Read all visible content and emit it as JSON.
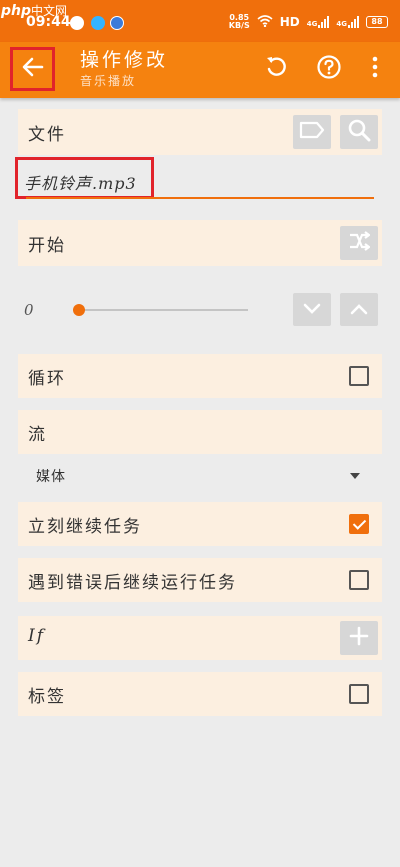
{
  "watermark": {
    "php": "php",
    "text": "中文网"
  },
  "status_bar": {
    "time": "09:44",
    "net_speed_value": "0.85",
    "net_speed_unit": "KB/S",
    "hd": "HD",
    "signal_1": "4G",
    "signal_2": "4G",
    "battery": "88"
  },
  "toolbar": {
    "title": "操作修改",
    "subtitle": "音乐播放",
    "back_icon": "arrow-left-icon",
    "undo_icon": "undo-icon",
    "help_icon": "help-circle-icon",
    "menu_icon": "more-vertical-icon"
  },
  "file_row": {
    "label": "文件",
    "file_value": "手机铃声.mp3"
  },
  "start_row": {
    "label": "开始"
  },
  "position": {
    "value": "0",
    "fraction": 0
  },
  "loop_row": {
    "label": "循环",
    "checked": false
  },
  "stream_row": {
    "label": "流",
    "selected": "媒体"
  },
  "continue_row": {
    "label": "立刻继续任务",
    "checked": true
  },
  "error_row": {
    "label": "遇到错误后继续运行任务",
    "checked": false
  },
  "if_row": {
    "label": "If"
  },
  "tag_row": {
    "label": "标签",
    "checked": false
  },
  "colors": {
    "status_bar": "#f06f0c",
    "toolbar": "#f5820f",
    "row_bg": "#fcefe0",
    "highlight": "#e1232b",
    "accent": "#f06f0c"
  }
}
